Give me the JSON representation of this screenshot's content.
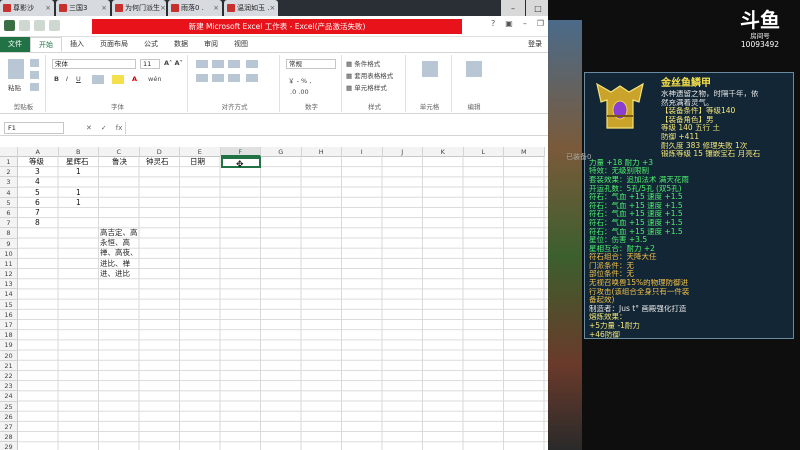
{
  "browser_tabs": [
    {
      "label": "尊影沙"
    },
    {
      "label": "三国3"
    },
    {
      "label": "为何门派生"
    },
    {
      "label": "雨落0 ."
    },
    {
      "label": "温润如玉 ."
    }
  ],
  "excel": {
    "title": "新建 Microsoft Excel 工作表 - Excel(产品激活失败)",
    "ribbon_tabs": [
      "文件",
      "开始",
      "插入",
      "页面布局",
      "公式",
      "数据",
      "审阅",
      "视图"
    ],
    "login": "登录",
    "ribbon": {
      "paste": "粘贴",
      "clipboard": "剪贴板",
      "font_name": "宋体",
      "font_size": "11",
      "font_group": "字体",
      "align_group": "对齐方式",
      "number_format": "常规",
      "number_group": "数字",
      "cond_format": "条件格式",
      "table_format": "套用表格格式",
      "cell_style": "单元格样式",
      "style_group": "样式",
      "cells_group": "单元格",
      "edit_group": "编辑"
    },
    "name_box": "F1",
    "columns": [
      "A",
      "B",
      "C",
      "D",
      "E",
      "F",
      "G",
      "H",
      "I",
      "J",
      "K",
      "L",
      "M"
    ],
    "selected_column": "F",
    "rows": [
      "1",
      "2",
      "3",
      "4",
      "5",
      "6",
      "7",
      "8",
      "9",
      "10",
      "11",
      "12",
      "13",
      "14",
      "15",
      "16",
      "17",
      "18",
      "19",
      "20",
      "21",
      "22",
      "23",
      "24",
      "25",
      "26",
      "27",
      "28",
      "29"
    ],
    "cells": {
      "A1": "等级",
      "B1": "星辉石",
      "C1": "鲁决",
      "D1": "钟灵石",
      "E1": "日期",
      "A2": "3",
      "B2": "1",
      "A3": "4",
      "A4": "5",
      "B4": "1",
      "A5": "6",
      "B5": "1",
      "A6": "7",
      "A7": "8",
      "C9": "高吉定、高永恒、高禅、高夜、进比、禅进、进比"
    }
  },
  "stream": {
    "platform": "斗鱼",
    "room_label": "房间号",
    "room_id": "10093492"
  },
  "tooltip": {
    "name": "金丝鱼鳞甲",
    "lines": [
      {
        "text": "水神遗留之物，时隔千年，依",
        "color": "wht"
      },
      {
        "text": "然充满着灵气。",
        "color": "wht"
      },
      {
        "text": "【装备条件】等级140",
        "color": "yel"
      },
      {
        "text": "【装备角色】男",
        "color": "yel"
      },
      {
        "text": "等级 140  五行 土",
        "color": "yel"
      },
      {
        "text": "防御 +411",
        "color": "yel"
      },
      {
        "text": "耐久度 383  修理失败 1次",
        "color": "yel"
      },
      {
        "text": "锻炼等级 15  镶嵌宝石 月亮石",
        "color": "yel"
      },
      {
        "text": "力量 +18 耐力 +3",
        "color": "grn"
      },
      {
        "text": "特效：无级别限制",
        "color": "grn"
      },
      {
        "text": "套装效果：追加法术 满天花雨",
        "color": "grn"
      },
      {
        "text": "开运孔数：5孔/5孔 (双5孔)",
        "color": "grn"
      },
      {
        "text": "符石：气血 +15  速度 +1.5",
        "color": "grn"
      },
      {
        "text": "符石：气血 +15  速度 +1.5",
        "color": "grn"
      },
      {
        "text": "符石：气血 +15  速度 +1.5",
        "color": "grn"
      },
      {
        "text": "符石：气血 +15  速度 +1.5",
        "color": "grn"
      },
      {
        "text": "符石：气血 +15  速度 +1.5",
        "color": "grn"
      },
      {
        "text": "星位：伤害 +3.5",
        "color": "grn"
      },
      {
        "text": "星相互合：耐力 +2",
        "color": "grn"
      },
      {
        "text": "符石组合：天降大任",
        "color": "org"
      },
      {
        "text": "门派条件：无",
        "color": "org"
      },
      {
        "text": "部位条件：无",
        "color": "org"
      },
      {
        "text": "无视召唤兽15%的物理防御进",
        "color": "org"
      },
      {
        "text": "行攻击(该组合全身只有一件装",
        "color": "org"
      },
      {
        "text": "备起效)",
        "color": "org"
      },
      {
        "text": "制造者：Jus t°   画殿强化打造",
        "color": "wht"
      },
      {
        "text": "熔炼效果：",
        "color": "yel"
      },
      {
        "text": "+5力量 -1耐力",
        "color": "yel"
      },
      {
        "text": "+46防御",
        "color": "yel"
      }
    ],
    "equipped": "已装备0"
  }
}
